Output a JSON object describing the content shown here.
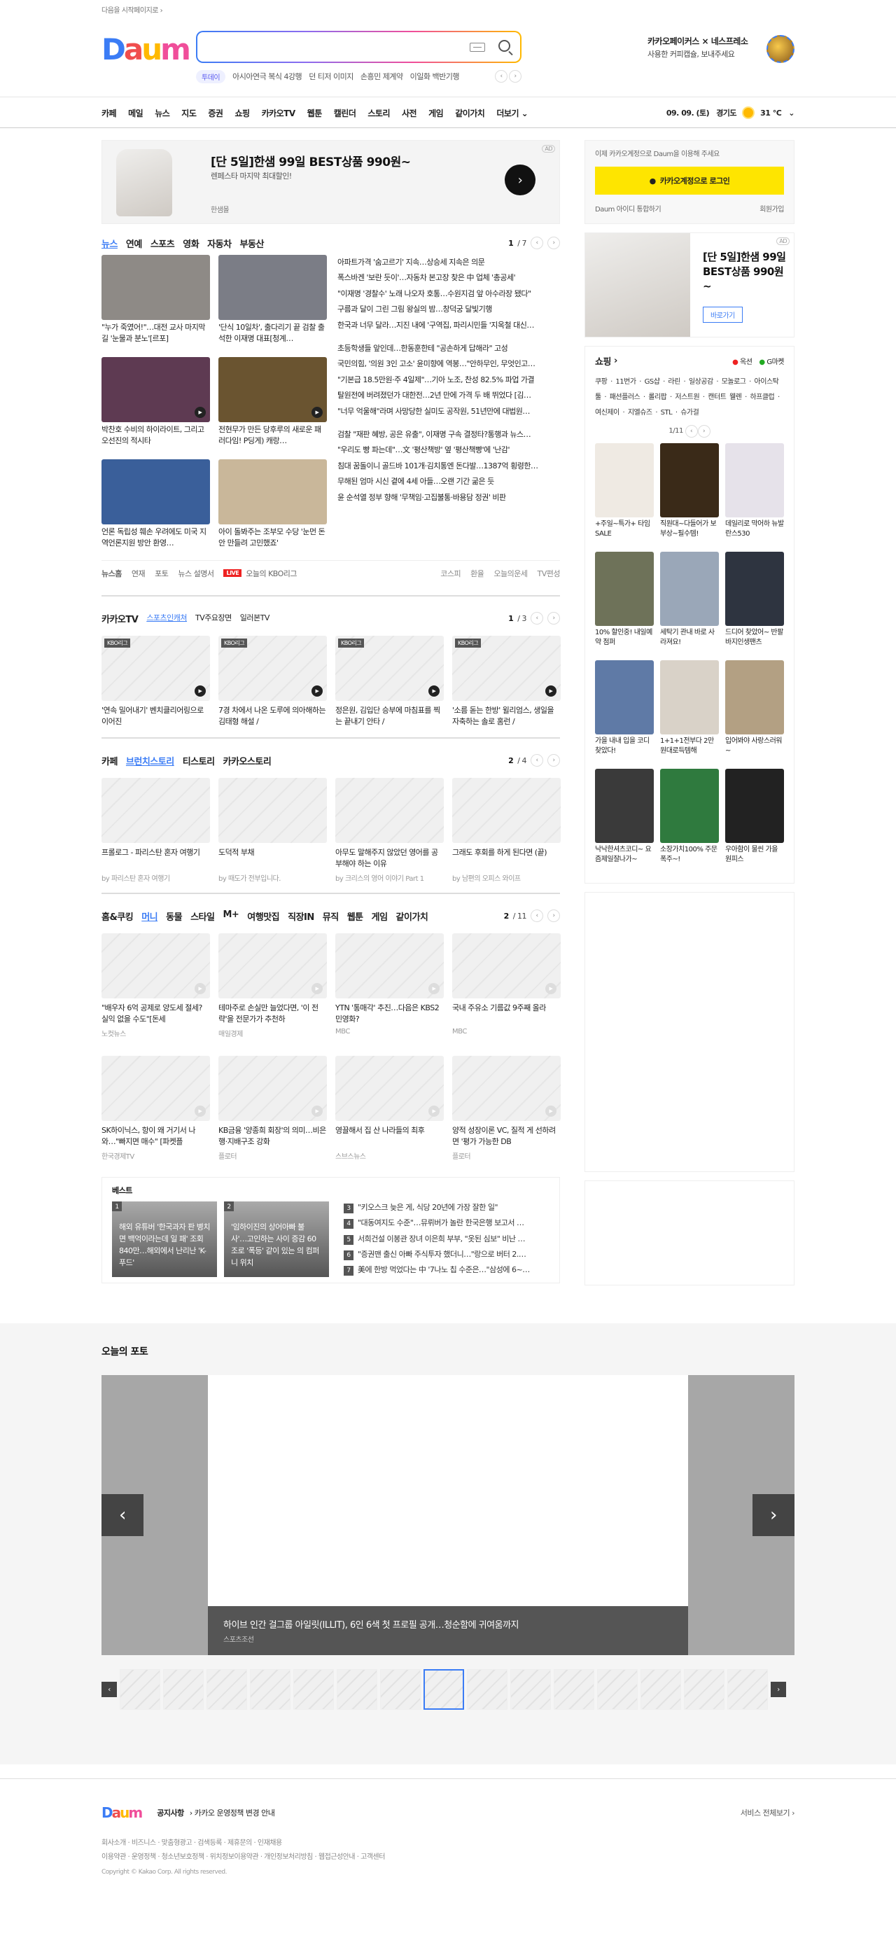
{
  "top": {
    "link": "다음을 시작페이지로"
  },
  "search": {
    "placeholder": "",
    "value": ""
  },
  "promo": {
    "line1": "카카오페이커스 × 네스프레소",
    "line2": "사용한 커피캡슐, 보내주세요"
  },
  "trend": {
    "badge": "투데이",
    "items": [
      "아시아연극 복식 4강행",
      "던 티저 이미지",
      "손흥민 제계약",
      "이일화 백반기행"
    ]
  },
  "gnb": {
    "menu": [
      "카페",
      "메일",
      "뉴스",
      "지도",
      "증권",
      "쇼핑",
      "카카오TV",
      "웹툰",
      "캘린더",
      "스토리",
      "사전",
      "게임",
      "같이가치",
      "더보기"
    ],
    "date": "09. 09. (토)",
    "region": "경기도",
    "temp": "31 °C"
  },
  "top_ad": {
    "title": "[단 5일]한샘 99일 BEST상품 990원~",
    "sub": "렌페스타 마지막 최대할인!",
    "brand": "한샘몰",
    "tag": "AD"
  },
  "news": {
    "tabs": [
      "뉴스",
      "연예",
      "스포츠",
      "영화",
      "자동차",
      "부동산"
    ],
    "page": "1",
    "total": "/ 7",
    "thumbs": [
      {
        "cap": "\"누가 죽였어!\"…대전 교사 마지막 길 '눈물과 분노'[르포]",
        "color": "#8e8a86"
      },
      {
        "cap": "'단식 10일차', 출다리기 끝 검찰 출석한 이재명 대표[청계…",
        "color": "#7b7d86"
      },
      {
        "cap": "박찬호 수비의 하이라이트, 그리고 오선진의 적시타",
        "color": "#5e3a52"
      },
      {
        "cap": "전현무가 만든 당후루의 새로운 패러다임! P딩게) 캐랑…",
        "color": "#6a5430"
      },
      {
        "cap": "언론 독립성 훼손 우려에도 미국 지역언론지원 방안 환영…",
        "color": "#3a5f9a"
      },
      {
        "cap": "아이 돌봐주는 조부모 수당 '눈먼 돈 안 만들려 고민했죠'",
        "color": "#c9b79a"
      }
    ],
    "list": [
      "아파트가격 '숨고르기' 지속…상승세 지속은 의문",
      "폭스바겐 '보란 듯이'…자동차 본고장 찾은 中 업체 '총공세'",
      "\"이재명 '경찰수' 노래 나오자 호통…수원지검 앞 아수라장 됐다\"",
      "구름과 달이 그린 그림 왕실의 밤…창덕궁 달빛기행",
      "한국과 너무 달라…지진 내에 '구역집, 파리시민들 '지옥철 대신…",
      "초등학생들 앞인데…한동훈한테 \"공손하게 답해라\" 고성",
      "국민의힘, '의원 3인 고소' 윤미향에 역봉…\"안하무인, 무엇인고…",
      "\"기본급 18.5만원·주 4일제\"…기아 노조, 찬성 82.5% 파업 가결",
      "탈원전에 버려졌던가 대한전…2년 만에 가격 두 배 뛰었다 [김…",
      "\"너무 억울해\"라며 사망당한 실미도 공작원, 51년만에 대법원…",
      "검찰 \"재판 혜방, 공은 유출\", 이재명 구속 결정타?통행과 뉴스…",
      "\"우리도 빵 파는데\"…文 '평산책방' 옆 '평산책빵'에 '난감'",
      "침대 꿈돌이니 골드바 101개·김치통엔 돈다발…1387억 횡령한…",
      "무해된 엄마 시신 곁에 4세 아들…오랜 기간 굶은 듯",
      "윤 순석열 정부 향해 '무책임·고집불통·바용담 정권' 비판"
    ],
    "footer": {
      "title": "뉴스홈",
      "links": [
        "연재",
        "포토",
        "뉴스 설명서"
      ],
      "live": "LIVE",
      "live_text": "오늘의 KBO리그",
      "right": [
        "코스피",
        "환율",
        "오늘의운세",
        "TV편성"
      ]
    }
  },
  "kakaotv": {
    "tabs": [
      "카카오TV",
      "스포츠인캐쳐",
      "TV주요장면",
      "일러본TV"
    ],
    "page": "1",
    "total": "/ 3",
    "cards": [
      {
        "tag": "KBO리그",
        "cap": "'연속 밀어내기' 벤치클리어링으로 이어진"
      },
      {
        "tag": "KBO리그",
        "cap": "7경 차에서 나온 도루에 의아해하는 김태형 해설 /"
      },
      {
        "tag": "KBO리그",
        "cap": "정은원, 김입단 승부에 마침표를 찍는 끝내기 안타 /"
      },
      {
        "tag": "KBO리그",
        "cap": "'소름 돋는 한방' 윌리엄스, 생일을 자축하는 솔로 홈런 /"
      }
    ]
  },
  "story": {
    "tabs": [
      "카페",
      "브런치스토리",
      "티스토리",
      "카카오스토리"
    ],
    "page": "2",
    "total": "/ 4",
    "cards": [
      {
        "cap": "프롤로그 - 파리스탄 혼자 여행기",
        "by": "by 파리스탄 혼자 여행기"
      },
      {
        "cap": "도덕적 부채",
        "by": "by 때도가 전부입니다."
      },
      {
        "cap": "아무도 말해주지 않았던 영어를 공부해야 하는 이유",
        "by": "by 크리스의 영어 이야기 Part 1"
      },
      {
        "cap": "그래도 후회를 하게 된다면 (끝)",
        "by": "by 남편의 오피스 와이프"
      }
    ]
  },
  "home": {
    "tabs": [
      "홈&쿠킹",
      "머니",
      "동물",
      "스타일",
      "M+",
      "여행맛집",
      "직장IN",
      "뮤직",
      "웹툰",
      "게임",
      "같이가치"
    ],
    "page": "2",
    "total": "/ 11",
    "cards": [
      {
        "cap": "\"배우자 6억 공제로 양도세 절세? 실익 없을 수도\"[돈세",
        "src": "노컷뉴스"
      },
      {
        "cap": "테마주로 손실만 늘었다면, '이 전략'을 전문가가 추천하",
        "src": "매일경제"
      },
      {
        "cap": "YTN '통매각' 추진…다음은 KBS2 민영화?",
        "src": "MBC"
      },
      {
        "cap": "국내 주유소 기름값 9주째 올라",
        "src": "MBC"
      },
      {
        "cap": "SK하이닉스, 항이 왜 거기서 나와…\"빠지면 매수\" [파켓플",
        "src": "한국경제TV"
      },
      {
        "cap": "KB금융 '양종희 회장'의 의미…비은행·지배구조 강화",
        "src": "플로터"
      },
      {
        "cap": "영끌해서 집 산 나라들의 최후",
        "src": "스브스뉴스"
      },
      {
        "cap": "양적 성장이론 VC, 질적 게 선하려면 '평가 가능한 DB",
        "src": "플로터"
      }
    ]
  },
  "best": {
    "title": "베스트",
    "imgs": [
      {
        "n": "1",
        "text": "해외 유튜버 '한국과자 판 병치면 백억이라는데 일 패' 조회 840만…해외에서 난리난 'K-푸드'"
      },
      {
        "n": "2",
        "text": "'임하이진의 상어아빠 불 사'…고인하는 사이 증감 60조로 '폭등' 같이 있는 의 컴퍼니 위치"
      }
    ],
    "list": [
      {
        "n": "3",
        "text": "\"키오스크 늦은 게, 식당 20년에 가장 잘한 일\""
      },
      {
        "n": "4",
        "text": "\"대동여지도 수준\"…뮤뤼버가 놀란 한국은행 보고서 …"
      },
      {
        "n": "5",
        "text": "서희건설 이봉관 장녀 이은희 부부, \"옷된 심보\" 비난 …"
      },
      {
        "n": "6",
        "text": "\"증권맨 출신 아빠 주식투자 했더니…\"랑으로 버터 2.…"
      },
      {
        "n": "7",
        "text": "美에 한방 먹었다는 中 '7나노 칩 수준은…\"삼성에 6~…"
      }
    ]
  },
  "login": {
    "text": "이제 카카오계정으로 Daum을 이용해 주세요",
    "button": "카카오계정으로 로그인",
    "left": "Daum 아이디 통합하기",
    "right": "회원가입"
  },
  "right_ad": {
    "title": "[단 5일]한샘 99일 BEST상품 990원~",
    "button": "바로가기",
    "tag": "AD"
  },
  "shopping": {
    "title": "쇼핑",
    "partners": [
      "옥션",
      "G마켓"
    ],
    "tags": "쿠팡 · 11번가 · GS샵 · 라린 · 일상공감 · 모놀로그 · 아이스탁툴 · 패션플러스 · 롤리팝 · 저스트원 · 캔터트 웰렌 · 하프클럽 · 여신제이 · 지엘슈즈 · STL · 슈가걸",
    "page": "1/11",
    "items": [
      {
        "cap": "+주일~특가+ 타임 SALE",
        "color": "#efeae3"
      },
      {
        "cap": "직원대~다들어가 보부상~필수템!",
        "color": "#3a2a18"
      },
      {
        "cap": "데일리로 막어하 뉴발란스530",
        "color": "#e6e2ea"
      },
      {
        "cap": "10% 할인중! 내일예약 점퍼",
        "color": "#6e7259"
      },
      {
        "cap": "세탁기 관내 바로 사라져요!",
        "color": "#9aa7b8"
      },
      {
        "cap": "드디어 찾았어~ 반팔바지인생팬츠",
        "color": "#2e3440"
      },
      {
        "cap": "가을 내내 입을 코디 찾았다!",
        "color": "#5f7aa6"
      },
      {
        "cap": "1+1+1전부다 2만원대로득템해",
        "color": "#d9d2c8"
      },
      {
        "cap": "입어봐야 사랑스러워~",
        "color": "#b3a083"
      },
      {
        "cap": "낙낙한셔츠코디~ 요즘제일잘나가~",
        "color": "#3a3a3a"
      },
      {
        "cap": "소장가치100% 주문 폭주~!",
        "color": "#2f7a3e"
      },
      {
        "cap": "우아함이 물씬 가을 원피스",
        "color": "#222222"
      }
    ]
  },
  "photo": {
    "title": "오늘의 포토",
    "caption": "하이브 인간 걸그룹 아일릿(ILLIT), 6인 6색 첫 프로필 공개…청순함에 귀여움까지",
    "source": "스포츠조선"
  },
  "footer": {
    "notice_label": "공지사항",
    "notice_text": "카카오 운영정책 변경 안내",
    "more": "서비스 전체보기",
    "links1": "회사소개 · 비즈니스 · 맞춤형광고 · 검색등록 · 제휴문의 · 인재채용",
    "links2": "이용약관 · 운영정책 · 청소년보호정책 · 위치정보이용약관 · 개인정보처리방침 · 웹접근성안내 · 고객센터",
    "copy": "Copyright © Kakao Corp. All rights reserved."
  }
}
